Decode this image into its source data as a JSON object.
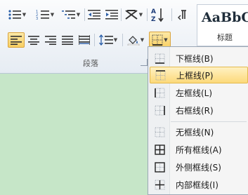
{
  "ribbon": {
    "paragraph_group_label": "段落",
    "styles": {
      "sample_text": "AaBbC",
      "normal_style_name": "标题"
    }
  },
  "border_menu": {
    "items": [
      {
        "label": "下框线(B)",
        "icon": "bottom-border-icon"
      },
      {
        "label": "上框线(P)",
        "icon": "top-border-icon",
        "highlighted": true
      },
      {
        "label": "左框线(L)",
        "icon": "left-border-icon"
      },
      {
        "label": "右框线(R)",
        "icon": "right-border-icon"
      },
      {
        "label": "无框线(N)",
        "icon": "no-border-icon"
      },
      {
        "label": "所有框线(A)",
        "icon": "all-borders-icon"
      },
      {
        "label": "外侧框线(S)",
        "icon": "outside-borders-icon"
      },
      {
        "label": "内部框线(I)",
        "icon": "inside-borders-icon"
      }
    ]
  },
  "colors": {
    "document_background": "#c6e6c8",
    "highlight": "#fcd97a"
  }
}
